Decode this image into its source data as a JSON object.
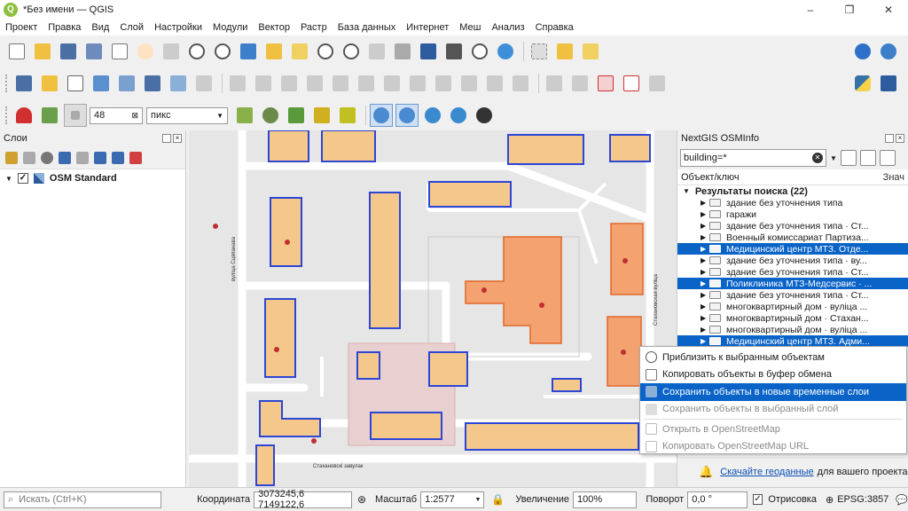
{
  "window": {
    "title": "*Без имени — QGIS",
    "logo": "Q",
    "controls": [
      "–",
      "❐",
      "✕"
    ]
  },
  "menu": [
    "Проект",
    "Правка",
    "Вид",
    "Слой",
    "Настройки",
    "Модули",
    "Вектор",
    "Растр",
    "База данных",
    "Интернет",
    "Меш",
    "Анализ",
    "Справка"
  ],
  "snapping": {
    "tolerance": "48",
    "units": "пикс"
  },
  "layers_panel": {
    "title": "Слои",
    "layers": [
      {
        "name": "OSM Standard",
        "checked": "✓"
      }
    ]
  },
  "osminfo_panel": {
    "title": "NextGIS OSMInfo",
    "query": "building=*",
    "col_key": "Объект/ключ",
    "col_value": "Знач",
    "results_label": "Результаты поиска (22)",
    "items": [
      {
        "text": "здание без уточнения типа",
        "selected": false
      },
      {
        "text": "гаражи",
        "selected": false
      },
      {
        "text": "здание без уточнения типа · Ст...",
        "selected": false
      },
      {
        "text": "Военный комиссариат Партиза...",
        "selected": false
      },
      {
        "text": "Медицинский центр МТЗ. Отде...",
        "selected": true
      },
      {
        "text": "здание без уточнения типа · ву...",
        "selected": false
      },
      {
        "text": "здание без уточнения типа · Ст...",
        "selected": false
      },
      {
        "text": "Поликлиника МТЗ-Медсервис · ...",
        "selected": true
      },
      {
        "text": "здание без уточнения типа · Ст...",
        "selected": false
      },
      {
        "text": "многоквартирный дом · вуліца ...",
        "selected": false
      },
      {
        "text": "многоквартирный дом · Стахан...",
        "selected": false
      },
      {
        "text": "многоквартирный дом · вуліца ...",
        "selected": false
      },
      {
        "text": "Медицинский центр МТЗ. Адми...",
        "selected": true
      }
    ],
    "notice_link": "Скачайте геоданные",
    "notice_text": "для вашего проекта"
  },
  "context_menu": {
    "items": [
      {
        "label": "Приблизить к выбранным объектам",
        "state": "normal"
      },
      {
        "label": "Копировать объекты в буфер обмена",
        "state": "normal"
      },
      {
        "label": "Сохранить объекты в новые временные слои",
        "state": "highlight"
      },
      {
        "label": "Сохранить объекты в выбранный слой",
        "state": "disabled"
      },
      {
        "label": "Открыть в OpenStreetMap",
        "state": "disabled"
      },
      {
        "label": "Копировать OpenStreetMap URL",
        "state": "disabled"
      }
    ]
  },
  "map_labels": {
    "street_left": "вуліца Сцяпанава",
    "street_right": "Стахановская вуліца",
    "street_bottom": "Стахановскі завулак"
  },
  "statusbar": {
    "search_placeholder": "Искать (Ctrl+K)",
    "coord_label": "Координата",
    "coord_value": "3073245,6  7149122,6",
    "scale_label": "Масштаб",
    "scale_value": "1:2577",
    "magnifier_label": "Увеличение",
    "magnifier_value": "100%",
    "rotation_label": "Поворот",
    "rotation_value": "0,0 °",
    "render_label": "Отрисовка",
    "render_checked": "✓",
    "crs": "EPSG:3857"
  }
}
